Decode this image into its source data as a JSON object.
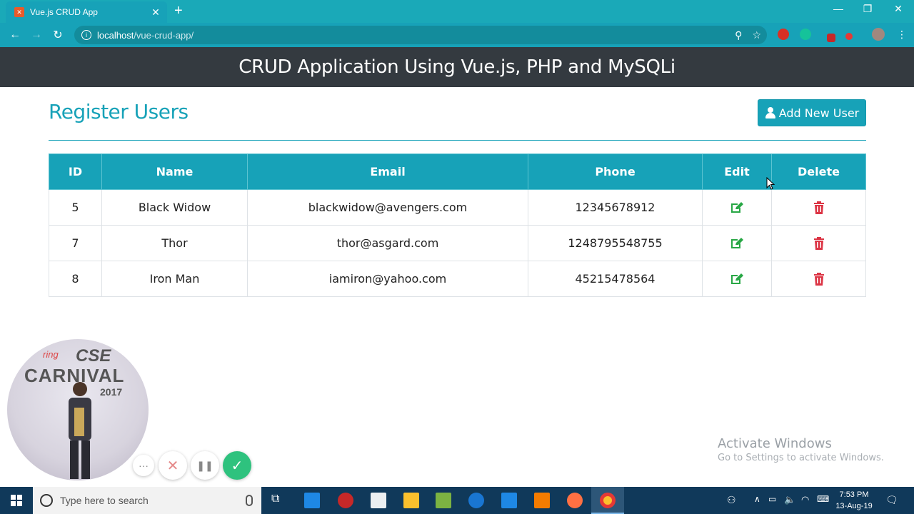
{
  "browser": {
    "tab_title": "Vue.js CRUD App",
    "url_host": "localhost",
    "url_path": "/vue-crud-app/"
  },
  "app": {
    "header_title": "CRUD Application Using Vue.js, PHP and MySQLi",
    "page_title": "Register Users",
    "add_button_label": "Add New User"
  },
  "table": {
    "columns": [
      "ID",
      "Name",
      "Email",
      "Phone",
      "Edit",
      "Delete"
    ],
    "rows": [
      {
        "id": "5",
        "name": "Black Widow",
        "email": "blackwidow@avengers.com",
        "phone": "12345678912"
      },
      {
        "id": "7",
        "name": "Thor",
        "email": "thor@asgard.com",
        "phone": "1248795548755"
      },
      {
        "id": "8",
        "name": "Iron Man",
        "email": "iamiron@yahoo.com",
        "phone": "45215478564"
      }
    ]
  },
  "webcam": {
    "line1": "ring",
    "line2": "CSE",
    "line3": "CARNIVAL",
    "line4": "2017"
  },
  "recorder_controls": {
    "more": "···",
    "cancel": "✕",
    "pause": "❚❚",
    "done": "✓"
  },
  "watermark": {
    "line1": "Activate Windows",
    "line2": "Go to Settings to activate Windows."
  },
  "taskbar": {
    "search_placeholder": "Type here to search",
    "time": "7:53 PM",
    "date": "13-Aug-19"
  },
  "colors": {
    "accent": "#17a2b8",
    "header_bg": "#343a40",
    "edit": "#28a745",
    "delete": "#dc3545"
  }
}
